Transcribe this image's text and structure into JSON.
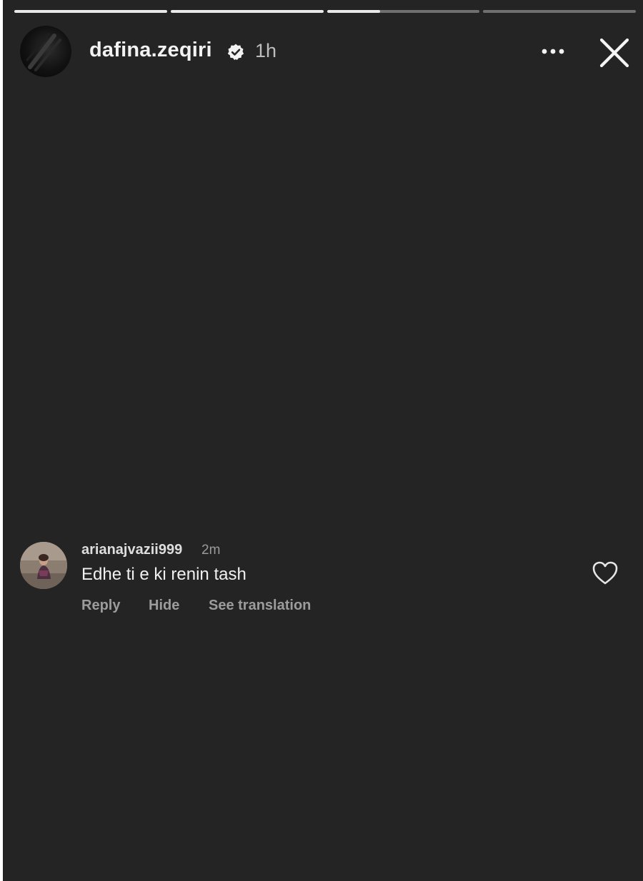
{
  "story": {
    "progress": [
      1,
      1,
      0.35,
      0
    ],
    "author": {
      "username": "dafina.zeqiri",
      "verified": true,
      "time": "1h",
      "avatar_icon": "profile-avatar"
    },
    "icons": {
      "more": "more-horizontal-icon",
      "close": "close-icon",
      "verified": "verified-badge-icon",
      "like": "heart-icon"
    }
  },
  "comment": {
    "username": "arianajvazii999",
    "time": "2m",
    "text": "Edhe ti e ki renin tash",
    "actions": {
      "reply": "Reply",
      "hide": "Hide",
      "see_translation": "See translation"
    }
  },
  "colors": {
    "background": "#242424",
    "text_primary": "#f2f2f2",
    "text_secondary": "#9c9c9c",
    "progress_done": "#e9e9e9"
  }
}
